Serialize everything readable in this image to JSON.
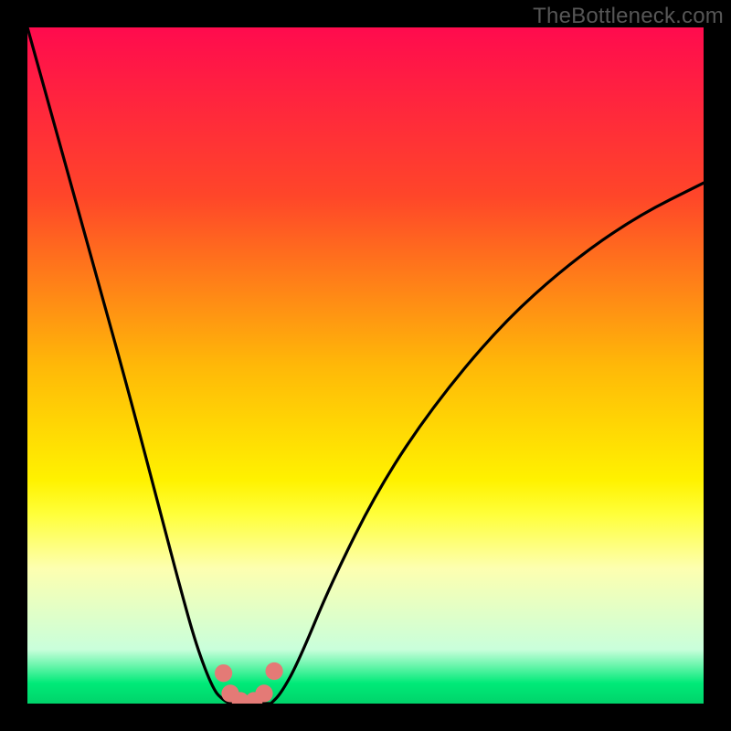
{
  "watermark": "TheBottleneck.com",
  "chart_data": {
    "type": "line",
    "title": "",
    "xlabel": "",
    "ylabel": "",
    "xlim": [
      0,
      1
    ],
    "ylim": [
      0,
      1
    ],
    "gradient_stops": [
      {
        "offset": 0.0,
        "color": "#ff0b4e"
      },
      {
        "offset": 0.25,
        "color": "#ff4629"
      },
      {
        "offset": 0.5,
        "color": "#ffb808"
      },
      {
        "offset": 0.67,
        "color": "#fff200"
      },
      {
        "offset": 0.72,
        "color": "#ffff3a"
      },
      {
        "offset": 0.8,
        "color": "#fdffb0"
      },
      {
        "offset": 0.92,
        "color": "#c9ffdb"
      },
      {
        "offset": 0.97,
        "color": "#00ea78"
      },
      {
        "offset": 1.0,
        "color": "#00d36a"
      }
    ],
    "series": [
      {
        "name": "left-branch",
        "x": [
          0.0,
          0.05,
          0.1,
          0.15,
          0.2,
          0.225,
          0.25,
          0.275,
          0.29,
          0.3
        ],
        "y": [
          1.0,
          0.82,
          0.64,
          0.46,
          0.27,
          0.175,
          0.085,
          0.02,
          0.005,
          0.0
        ]
      },
      {
        "name": "valley-floor",
        "x": [
          0.3,
          0.315,
          0.33,
          0.345,
          0.36
        ],
        "y": [
          0.0,
          0.0,
          0.0,
          0.0,
          0.0
        ]
      },
      {
        "name": "right-branch",
        "x": [
          0.36,
          0.375,
          0.4,
          0.45,
          0.52,
          0.6,
          0.7,
          0.8,
          0.9,
          1.0
        ],
        "y": [
          0.0,
          0.015,
          0.06,
          0.18,
          0.32,
          0.44,
          0.56,
          0.65,
          0.72,
          0.77
        ]
      }
    ],
    "markers": {
      "name": "bottleneck-dots",
      "color": "#e47a76",
      "points": [
        {
          "x": 0.29,
          "y": 0.045
        },
        {
          "x": 0.3,
          "y": 0.015
        },
        {
          "x": 0.315,
          "y": 0.004
        },
        {
          "x": 0.335,
          "y": 0.004
        },
        {
          "x": 0.35,
          "y": 0.015
        },
        {
          "x": 0.365,
          "y": 0.048
        }
      ],
      "radius_frac": 0.013
    },
    "annotations": []
  }
}
